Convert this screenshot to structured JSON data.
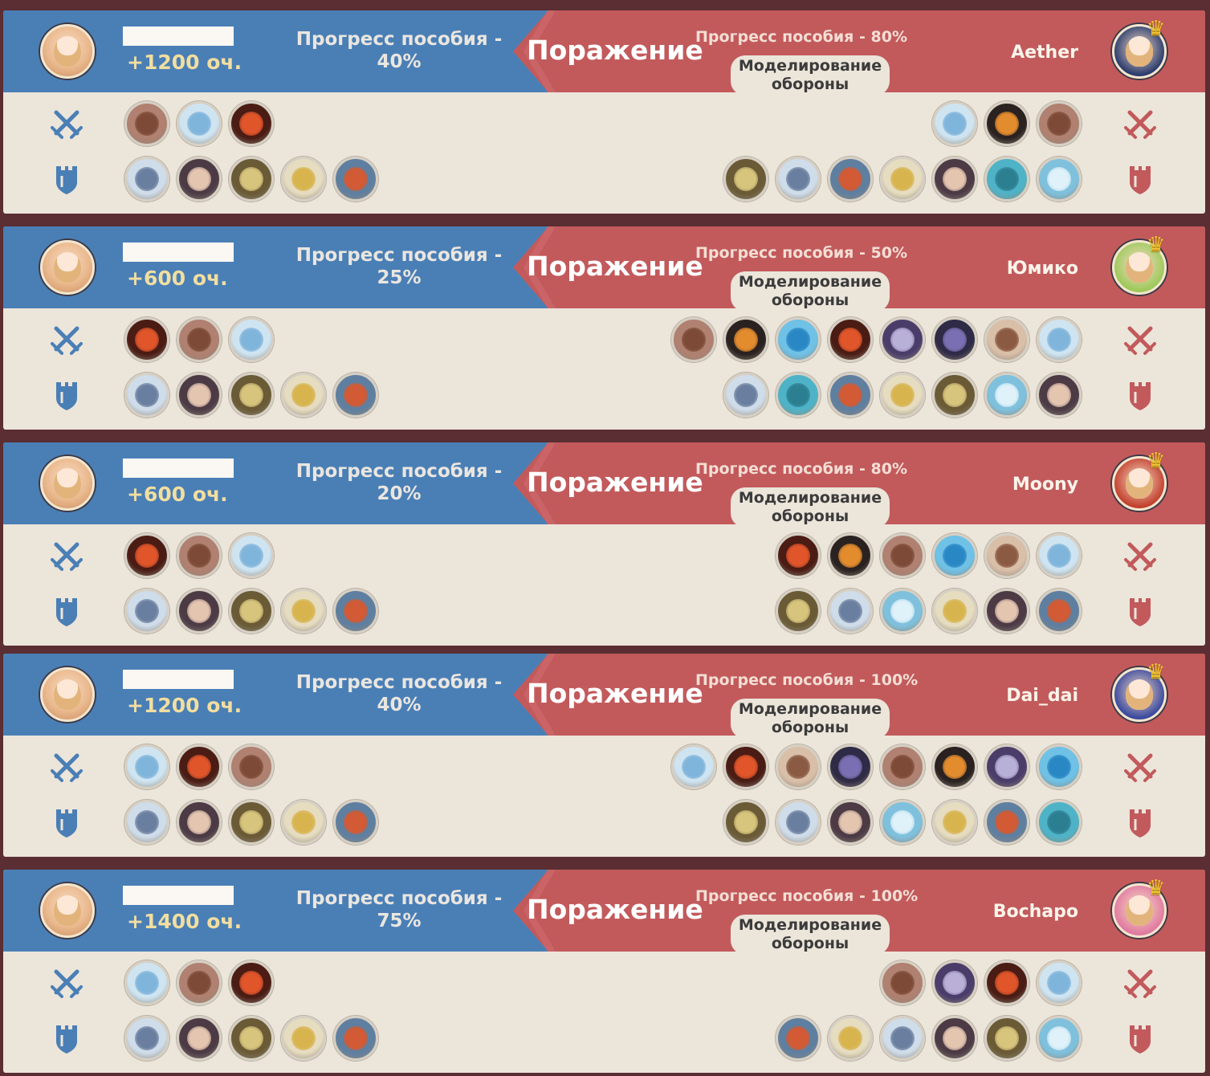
{
  "labels": {
    "atk_icon": "crossed-swords-icon",
    "def_icon": "shield-tower-icon"
  },
  "colors": {
    "blue": "#4a7fb6",
    "red": "#c25a5c",
    "panel": "#ece5da"
  },
  "card_types": {
    "rock-golem": {
      "bg": "#b08070",
      "inner": "#7c4a36"
    },
    "ice-crystal": {
      "bg": "#cfe4f1",
      "inner": "#7fb4db"
    },
    "fire-core": {
      "bg": "#4a1c14",
      "inner": "#e0552a"
    },
    "frost-dragon": {
      "bg": "#cfdce9",
      "inner": "#6a7f9f"
    },
    "masked-man": {
      "bg": "#4c3a45",
      "inner": "#e3c5b0"
    },
    "dark-armor": {
      "bg": "#6a5a35",
      "inner": "#d8c57d"
    },
    "golden-fountain": {
      "bg": "#e6dcc0",
      "inner": "#d8b44f"
    },
    "blue-tower": {
      "bg": "#5f7fa0",
      "inner": "#d25a34"
    },
    "sun-orb": {
      "bg": "#2a2220",
      "inner": "#e38c2e"
    },
    "cyan-slime": {
      "bg": "#4fb3c7",
      "inner": "#2c7f91"
    },
    "ice-flower": {
      "bg": "#7fc1dd",
      "inner": "#dff1f9"
    },
    "blue-orb": {
      "bg": "#6fc1e6",
      "inner": "#2987c4"
    },
    "purple-mask": {
      "bg": "#4a3d6a",
      "inner": "#b9b0d8"
    },
    "shadow-crawler": {
      "bg": "#2f2a45",
      "inner": "#7a6fb2"
    },
    "horned-skull": {
      "bg": "#d9bfa8",
      "inner": "#8a5a43"
    }
  },
  "matches": [
    {
      "points": "+1200 оч.",
      "my_progress_line1": "Прогресс пособия -",
      "my_progress_line2": "40%",
      "result": "Поражение",
      "opp_progress": "Прогресс пособия - 80%",
      "opp_name": "Aether",
      "mode_line1": "Моделирование",
      "mode_line2": "обороны",
      "opp_avatar_color": "#2b3d6e",
      "my_attack": [
        "rock-golem",
        "ice-crystal",
        "fire-core"
      ],
      "my_defense": [
        "frost-dragon",
        "masked-man",
        "dark-armor",
        "golden-fountain",
        "blue-tower"
      ],
      "opp_attack": [
        "ice-crystal",
        "sun-orb",
        "rock-golem"
      ],
      "opp_defense": [
        "dark-armor",
        "frost-dragon",
        "blue-tower",
        "golden-fountain",
        "masked-man",
        "cyan-slime",
        "ice-flower"
      ]
    },
    {
      "points": "+600 оч.",
      "my_progress_line1": "Прогресс пособия -",
      "my_progress_line2": "25%",
      "result": "Поражение",
      "opp_progress": "Прогресс пособия - 50%",
      "opp_name": "Юмико",
      "mode_line1": "Моделирование",
      "mode_line2": "обороны",
      "opp_avatar_color": "#9dc95a",
      "my_attack": [
        "fire-core",
        "rock-golem",
        "ice-crystal"
      ],
      "my_defense": [
        "frost-dragon",
        "masked-man",
        "dark-armor",
        "golden-fountain",
        "blue-tower"
      ],
      "opp_attack": [
        "rock-golem",
        "sun-orb",
        "blue-orb",
        "fire-core",
        "purple-mask",
        "shadow-crawler",
        "horned-skull",
        "ice-crystal"
      ],
      "opp_defense": [
        "frost-dragon",
        "cyan-slime",
        "blue-tower",
        "golden-fountain",
        "dark-armor",
        "ice-flower",
        "masked-man"
      ]
    },
    {
      "points": "+600 оч.",
      "my_progress_line1": "Прогресс пособия -",
      "my_progress_line2": "20%",
      "result": "Поражение",
      "opp_progress": "Прогресс пособия - 80%",
      "opp_name": "Moony",
      "mode_line1": "Моделирование",
      "mode_line2": "обороны",
      "opp_avatar_color": "#c2412e",
      "my_attack": [
        "fire-core",
        "rock-golem",
        "ice-crystal"
      ],
      "my_defense": [
        "frost-dragon",
        "masked-man",
        "dark-armor",
        "golden-fountain",
        "blue-tower"
      ],
      "opp_attack": [
        "fire-core",
        "sun-orb",
        "rock-golem",
        "blue-orb",
        "horned-skull",
        "ice-crystal"
      ],
      "opp_defense": [
        "dark-armor",
        "frost-dragon",
        "ice-flower",
        "golden-fountain",
        "masked-man",
        "blue-tower"
      ]
    },
    {
      "points": "+1200 оч.",
      "my_progress_line1": "Прогресс пособия -",
      "my_progress_line2": "40%",
      "result": "Поражение",
      "opp_progress": "Прогресс пособия - 100%",
      "opp_name": "Dai_dai",
      "mode_line1": "Моделирование",
      "mode_line2": "обороны",
      "opp_avatar_color": "#3a4a9e",
      "my_attack": [
        "ice-crystal",
        "fire-core",
        "rock-golem"
      ],
      "my_defense": [
        "frost-dragon",
        "masked-man",
        "dark-armor",
        "golden-fountain",
        "blue-tower"
      ],
      "opp_attack": [
        "ice-crystal",
        "fire-core",
        "horned-skull",
        "shadow-crawler",
        "rock-golem",
        "sun-orb",
        "purple-mask",
        "blue-orb"
      ],
      "opp_defense": [
        "dark-armor",
        "frost-dragon",
        "masked-man",
        "ice-flower",
        "golden-fountain",
        "blue-tower",
        "cyan-slime"
      ]
    },
    {
      "points": "+1400 оч.",
      "my_progress_line1": "Прогресс пособия -",
      "my_progress_line2": "75%",
      "result": "Поражение",
      "opp_progress": "Прогресс пособия - 100%",
      "opp_name": "Bochapo",
      "mode_line1": "Моделирование",
      "mode_line2": "обороны",
      "opp_avatar_color": "#e07aa0",
      "my_attack": [
        "ice-crystal",
        "rock-golem",
        "fire-core"
      ],
      "my_defense": [
        "frost-dragon",
        "masked-man",
        "dark-armor",
        "golden-fountain",
        "blue-tower"
      ],
      "opp_attack": [
        "rock-golem",
        "purple-mask",
        "fire-core",
        "ice-crystal"
      ],
      "opp_defense": [
        "blue-tower",
        "golden-fountain",
        "frost-dragon",
        "masked-man",
        "dark-armor",
        "ice-flower"
      ]
    }
  ]
}
